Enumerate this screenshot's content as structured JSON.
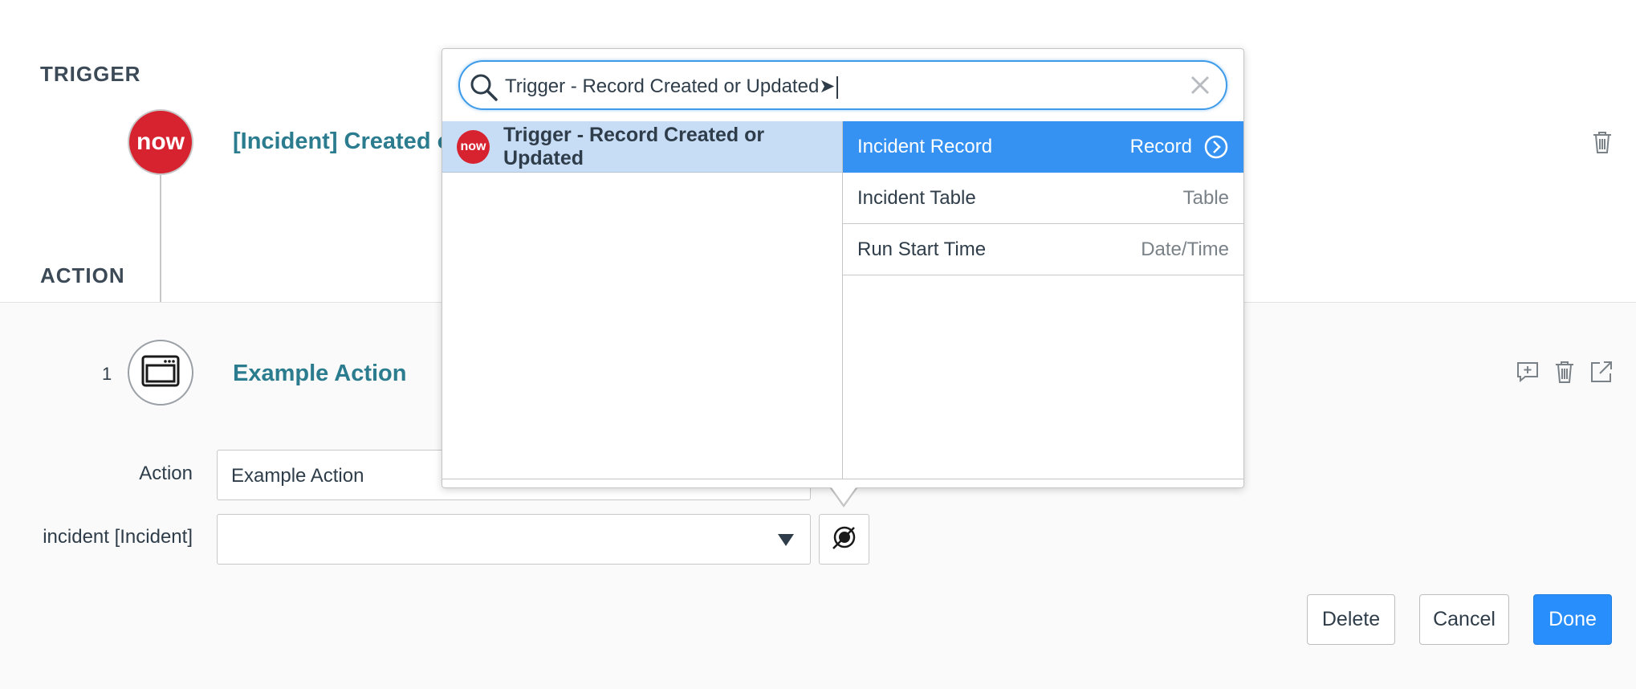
{
  "trigger": {
    "section_label": "TRIGGER",
    "logo_text": "now",
    "title": "[Incident] Created or"
  },
  "action": {
    "section_label": "ACTION",
    "step_number": "1",
    "title": "Example Action",
    "fields": {
      "action_label": "Action",
      "action_value": "Example Action",
      "incident_label": "incident [Incident]",
      "incident_value": ""
    },
    "buttons": {
      "delete": "Delete",
      "cancel": "Cancel",
      "done": "Done"
    }
  },
  "picker": {
    "search_value": "Trigger - Record Created or Updated➤",
    "left_items": [
      {
        "logo_text": "now",
        "label": "Trigger - Record Created or Updated",
        "selected": true
      }
    ],
    "right_items": [
      {
        "name": "Incident Record",
        "type": "Record",
        "selected": true,
        "has_children": true
      },
      {
        "name": "Incident Table",
        "type": "Table",
        "selected": false
      },
      {
        "name": "Run Start Time",
        "type": "Date/Time",
        "selected": false
      }
    ]
  },
  "colors": {
    "accent": "#278efc",
    "selected_row": "#3592f2",
    "left_selected_row": "#c7dcf5",
    "link": "#2b7c8f",
    "brand_red": "#d7232f"
  },
  "icons": {
    "search": "search-icon",
    "clear": "close-icon",
    "trash": "trash-icon",
    "comment": "comment-add-icon",
    "open": "open-external-icon",
    "chevron": "chevron-right-circle-icon",
    "data_pill": "data-pill-picker-icon",
    "action_type": "browser-window-icon"
  }
}
